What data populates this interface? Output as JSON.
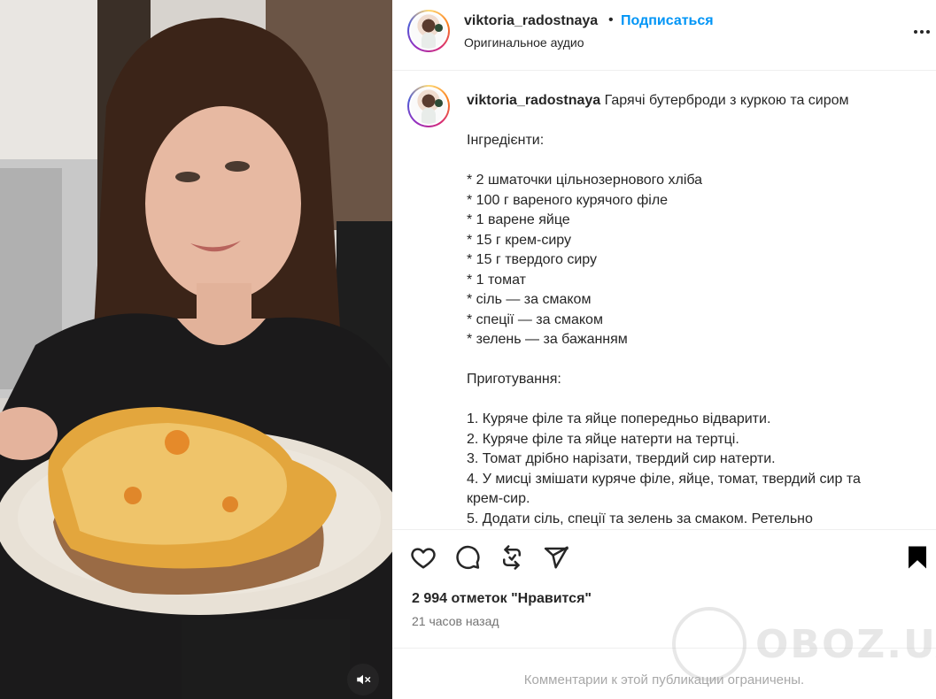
{
  "post": {
    "username": "viktoria_radostnaya",
    "separator": "•",
    "follow_label": "Подписаться",
    "audio": "Оригинальное аудио"
  },
  "caption": {
    "username": "viktoria_radostnaya",
    "title": "Гарячі бутерброди з куркою та сиром",
    "lines": [
      "",
      "Інгредієнти:",
      "",
      "* 2 шматочки цільнозернового хліба",
      "* 100 г вареного курячого філе",
      "* 1 варене яйце",
      "* 15 г крем-сиру",
      "* 15 г твердого сиру",
      "* 1 томат",
      "* сіль — за смаком",
      "* спеції — за смаком",
      "* зелень — за бажанням",
      "",
      "Приготування:",
      "",
      "1. Куряче філе та яйце попередньо відварити.",
      "2. Куряче філе та яйце натерти на тертці.",
      "3. Томат дрібно нарізати, твердий сир натерти.",
      "4. У мисці змішати куряче філе, яйце, томат, твердий сир та",
      "крем-сир.",
      "5. Додати сіль, спеції та зелень за смаком. Ретельно"
    ]
  },
  "stats": {
    "likes": "2 994 отметок \"Нравится\"",
    "time_ago": "21 часов назад"
  },
  "comments_closed": "Комментарии к этой публикации ограничены.",
  "watermark": "OBOZ.UA",
  "icons": {
    "like": "heart-icon",
    "comment": "comment-icon",
    "repost": "repost-icon",
    "share": "send-icon",
    "save": "bookmark-icon",
    "more": "more-icon",
    "mute": "muted-speaker-icon"
  }
}
